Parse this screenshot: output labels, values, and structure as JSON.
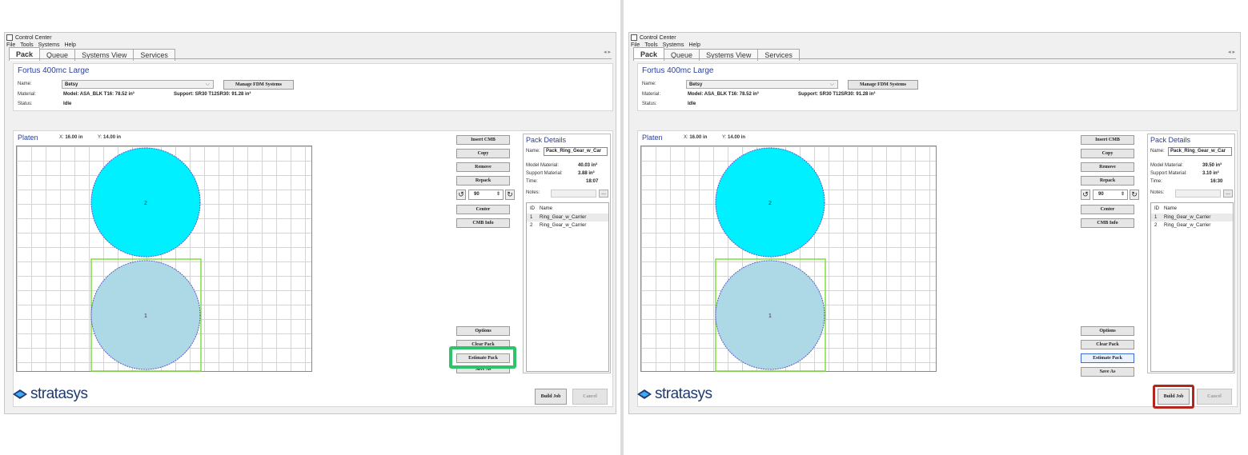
{
  "window": {
    "title": "Control Center"
  },
  "menu": [
    "File",
    "Tools",
    "Systems",
    "Help"
  ],
  "tabs": [
    "Pack",
    "Queue",
    "Systems View",
    "Services"
  ],
  "tab_scroll": "◂ ▸",
  "system": {
    "title": "Fortus 400mc Large",
    "name_label": "Name:",
    "name_value": "Betsy",
    "manage_button": "Manage FDM Systems",
    "material_label": "Material:",
    "model_material": "Model: ASA_BLK T16: 78.52 in³",
    "support_material": "Support: SR30 T12SR30: 91.28 in³",
    "status_label": "Status:",
    "status_value": "Idle"
  },
  "platen": {
    "title": "Platen",
    "x_label": "X:",
    "x_value": "16.00 in",
    "y_label": "Y:",
    "y_value": "14.00 in",
    "parts": [
      "2",
      "1"
    ]
  },
  "side_buttons": {
    "insert_cmb": "Insert CMB",
    "copy": "Copy",
    "remove": "Remove",
    "repack": "Repack",
    "rotation": "90",
    "center": "Center",
    "cmb_info": "CMB Info",
    "options": "Options",
    "clear_pack": "Clear Pack",
    "estimate_pack": "Estimate Pack",
    "save_as": "Save As"
  },
  "details_left": {
    "title": "Pack Details",
    "name_label": "Name:",
    "name_value": "Pack_Ring_Gear_w_Car",
    "model_material_label": "Model Material:",
    "model_material_value": "40.03 in³",
    "support_material_label": "Support Material:",
    "support_material_value": "3.88 in³",
    "time_label": "Time:",
    "time_value": "18:07",
    "notes_label": "Notes:",
    "notes_button": "...",
    "list_header_id": "ID",
    "list_header_name": "Name",
    "rows": [
      {
        "id": "1",
        "name": "Ring_Gear_w_Carrier"
      },
      {
        "id": "2",
        "name": "Ring_Gear_w_Carrier"
      }
    ]
  },
  "details_right": {
    "title": "Pack Details",
    "name_label": "Name:",
    "name_value": "Pack_Ring_Gear_w_Car",
    "model_material_label": "Model Material:",
    "model_material_value": "39.50 in³",
    "support_material_label": "Support Material:",
    "support_material_value": "3.10 in³",
    "time_label": "Time:",
    "time_value": "16:30",
    "notes_label": "Notes:",
    "notes_button": "...",
    "list_header_id": "ID",
    "list_header_name": "Name",
    "rows": [
      {
        "id": "1",
        "name": "Ring_Gear_w_Carrier"
      },
      {
        "id": "2",
        "name": "Ring_Gear_w_Carrier"
      }
    ]
  },
  "footer": {
    "logo": "stratasys",
    "build_job": "Build Job",
    "cancel": "Cancel"
  },
  "colors": {
    "part_unselected": "#00f0ff",
    "part_selected": "#add8e6",
    "selection_box": "#7fe03a",
    "callout_green": "#2ec46b",
    "callout_red": "#b3261e",
    "heading_blue": "#2a3f9d"
  }
}
